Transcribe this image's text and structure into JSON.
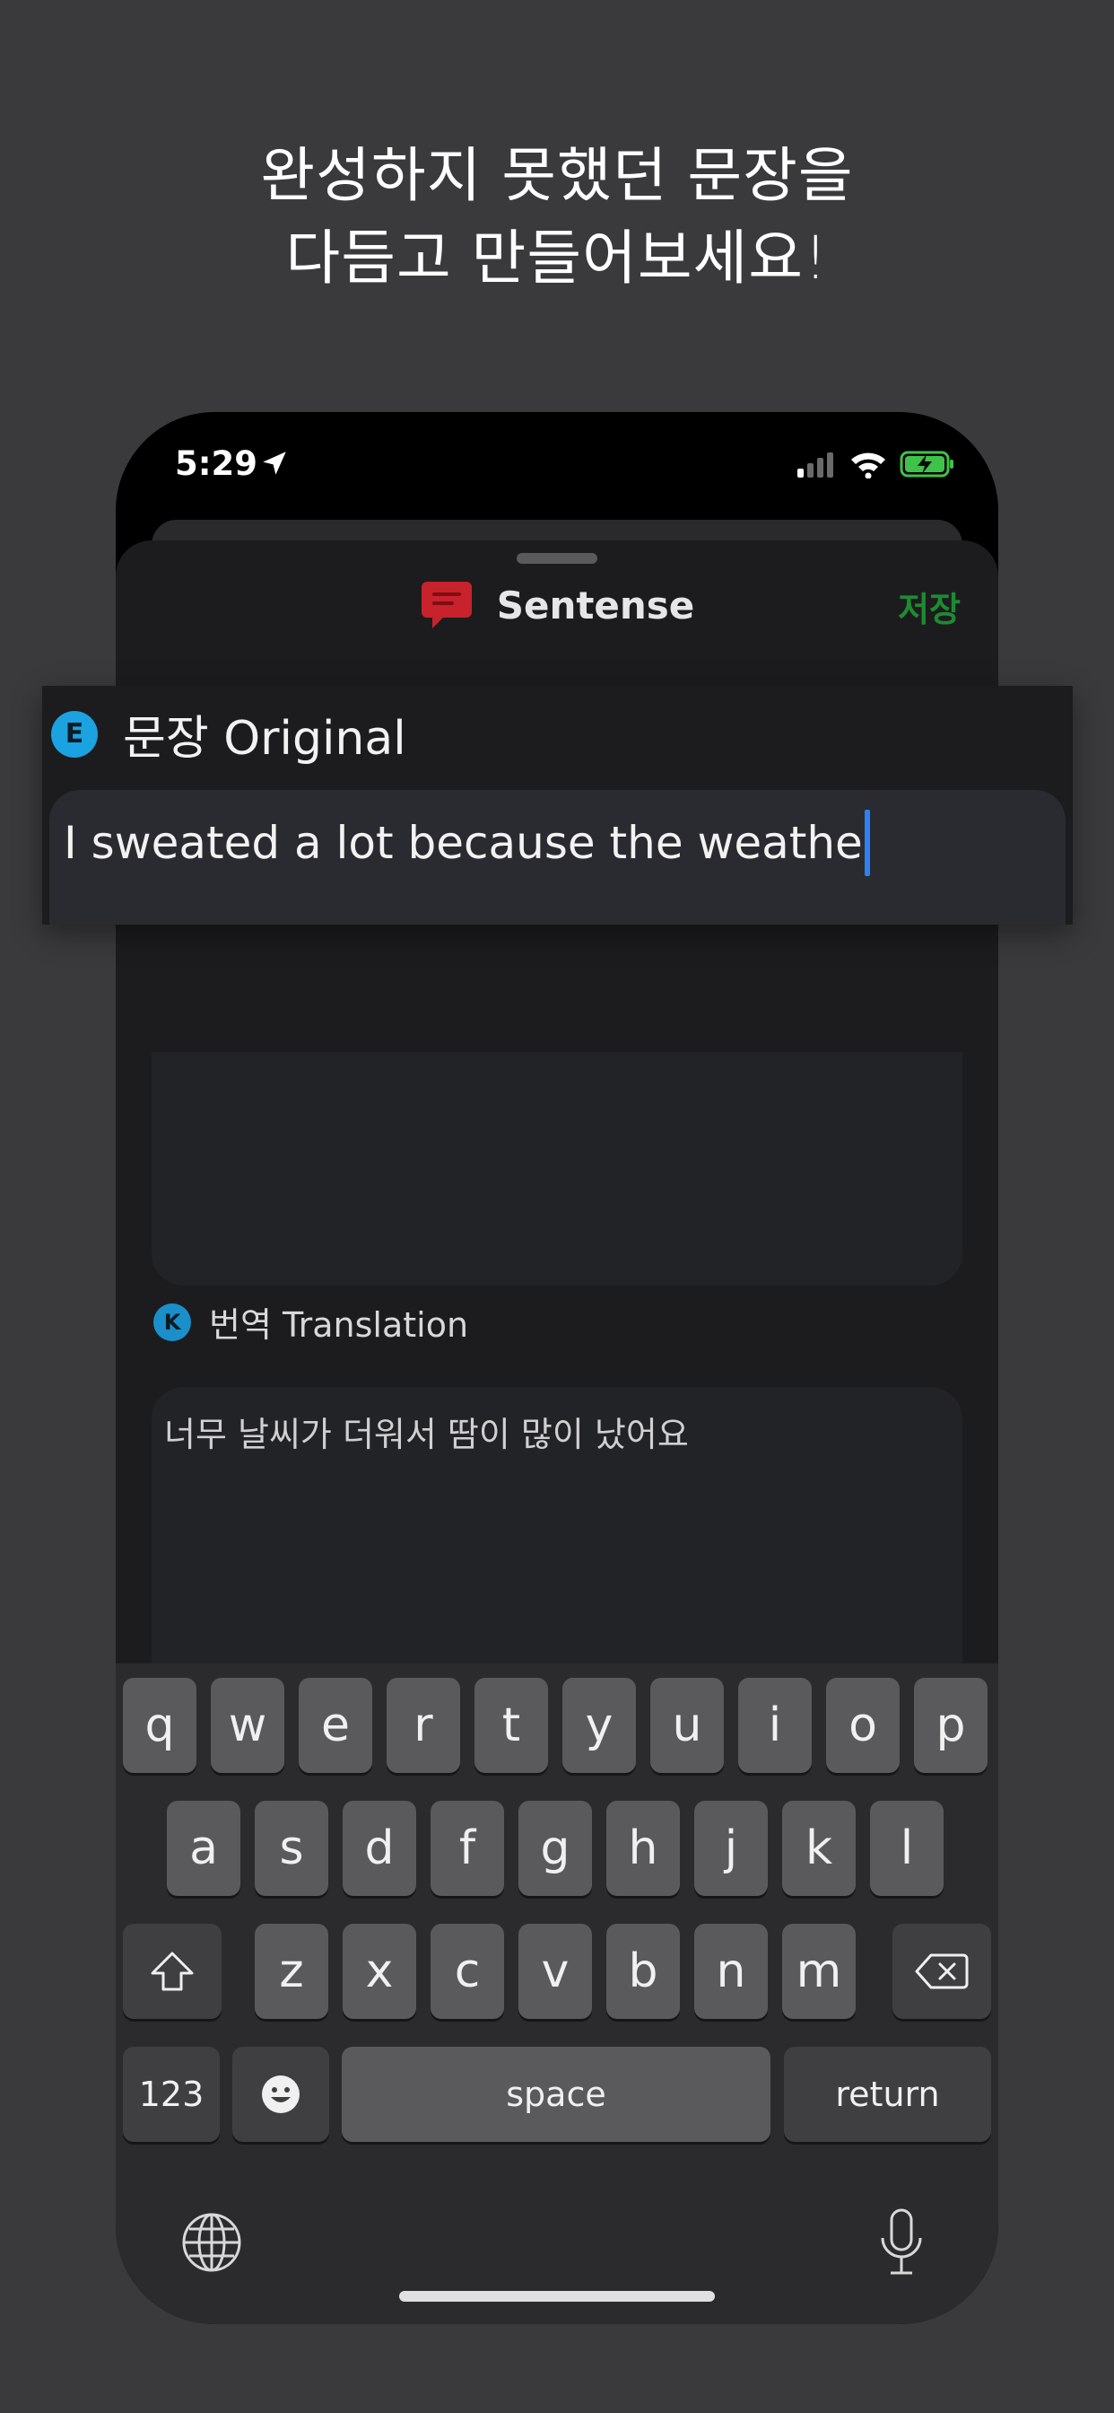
{
  "promo": {
    "line1": "완성하지 못했던 문장을",
    "line2": "다듬고 만들어보세요!"
  },
  "status_bar": {
    "time": "5:29"
  },
  "header": {
    "app_name": "Sentense",
    "save_label": "저장",
    "save_color": "#1e8a33",
    "icon": "chat-bubble-icon"
  },
  "original": {
    "badge": "E",
    "label": "문장 Original",
    "value": "I sweated a lot because the weathe"
  },
  "translation": {
    "badge": "K",
    "label": "번역 Translation",
    "value": "너무 날씨가 더워서 땀이 많이 났어요"
  },
  "keyboard": {
    "row1": [
      "q",
      "w",
      "e",
      "r",
      "t",
      "y",
      "u",
      "i",
      "o",
      "p"
    ],
    "row2": [
      "a",
      "s",
      "d",
      "f",
      "g",
      "h",
      "j",
      "k",
      "l"
    ],
    "row3": [
      "z",
      "x",
      "c",
      "v",
      "b",
      "n",
      "m"
    ],
    "numbers_label": "123",
    "space_label": "space",
    "return_label": "return"
  },
  "colors": {
    "accent_caret": "#2f7ff5",
    "badge_blue": "#1aa3e0",
    "app_icon_red": "#c8222d"
  }
}
